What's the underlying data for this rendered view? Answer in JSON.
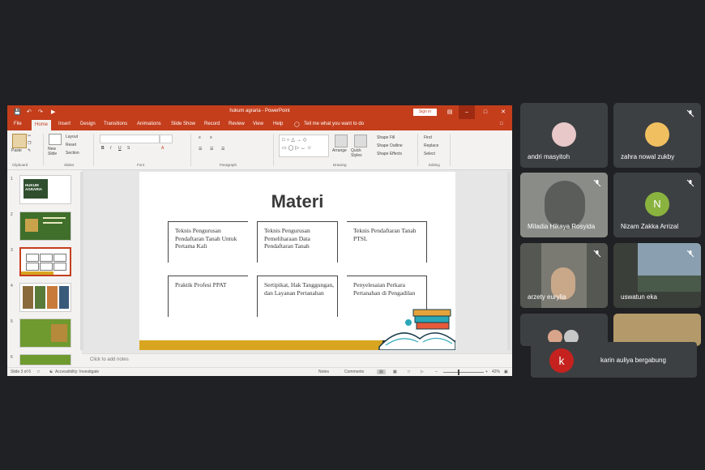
{
  "ppt": {
    "title": "hukum agraria - PowerPoint",
    "signin": "Sign in",
    "menu": [
      "File",
      "Home",
      "Insert",
      "Design",
      "Transitions",
      "Animations",
      "Slide Show",
      "Record",
      "Review",
      "View",
      "Help"
    ],
    "tellme": "Tell me what you want to do",
    "ribbon": {
      "paste": "Paste",
      "new_slide": "New Slide",
      "layout": "Layout",
      "reset": "Reset",
      "section": "Section",
      "arrange": "Arrange",
      "quick_styles": "Quick Styles",
      "shape_fill": "Shape Fill",
      "shape_outline": "Shape Outline",
      "shape_effects": "Shape Effects",
      "find": "Find",
      "replace": "Replace",
      "select": "Select",
      "groups": [
        "Clipboard",
        "Slides",
        "Font",
        "Paragraph",
        "Drawing",
        "Editing"
      ]
    },
    "thumb_numbers": [
      "1",
      "2",
      "3",
      "4",
      "5",
      "6"
    ],
    "thumb1_text": "HUKUM AGRARIA",
    "slide": {
      "title": "Materi",
      "boxes": [
        "Teknis Pengurusan Pendaftaran Tanah Untuk Pertama Kali",
        "Teknis Pengurusan Pemeliharaan Data Pendaftaran Tanah",
        "Teknis Pendaftaran Tanah PTSL",
        "Praktik Profesi PPAT",
        "Sertipikat, Hak Tanggungan, dan Layanan Pertanahan",
        "Penyelesaian Perkara Pertanahan di Pengadilan"
      ]
    },
    "notes_placeholder": "Click to add notes",
    "status": {
      "slide_info": "Slide 3 of 6",
      "accessibility": "Accessibility: Investigate",
      "notes": "Notes",
      "comments": "Comments",
      "zoom": "42%"
    }
  },
  "participants": [
    {
      "name": "andri masyitoh"
    },
    {
      "name": "zahra nowal zukby"
    },
    {
      "name": "Miladia Hikaya Rosyida"
    },
    {
      "name": "Nizam Zakka Arrizal",
      "initial": "N"
    },
    {
      "name": "arzety eurylia"
    },
    {
      "name": "uswatun eka"
    }
  ],
  "notification": {
    "initial": "k",
    "text": "karin auliya bergabung"
  },
  "colors": {
    "accent": "#c43e1c",
    "meet_bg": "#202124",
    "tile_bg": "#3c4043",
    "gold": "#d9a520",
    "avatar_n": "#8ab23f",
    "avatar_k": "#c5221f"
  }
}
